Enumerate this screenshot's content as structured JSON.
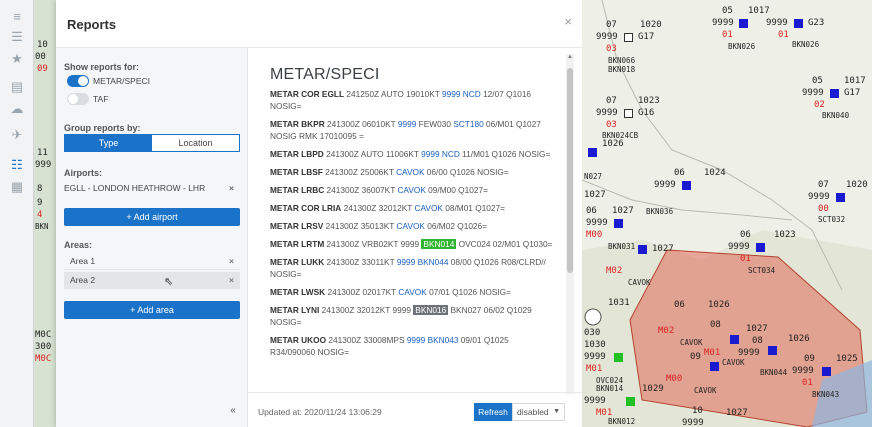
{
  "panel": {
    "title": "Reports",
    "close": "×"
  },
  "settings": {
    "show_label": "Show reports for:",
    "toggle_metar": "METAR/SPECI",
    "toggle_taf": "TAF",
    "group_label": "Group reports by:",
    "group_type": "Type",
    "group_location": "Location",
    "airports_label": "Airports:",
    "airport_1": "EGLL - LONDON HEATHROW - LHR",
    "add_airport": "+ Add airport",
    "areas_label": "Areas:",
    "area_1": "Area 1",
    "area_2": "Area 2",
    "add_area": "+ Add area",
    "remove": "×",
    "collapse": "«"
  },
  "reports": {
    "title": "METAR/SPECI"
  },
  "footer": {
    "updated": "Updated at: 2020/11/24 13:06:29",
    "refresh": "Refresh",
    "mode": "disabled"
  },
  "colors": {
    "accent": "#1a73c9",
    "polygon": "#e06a5a"
  }
}
